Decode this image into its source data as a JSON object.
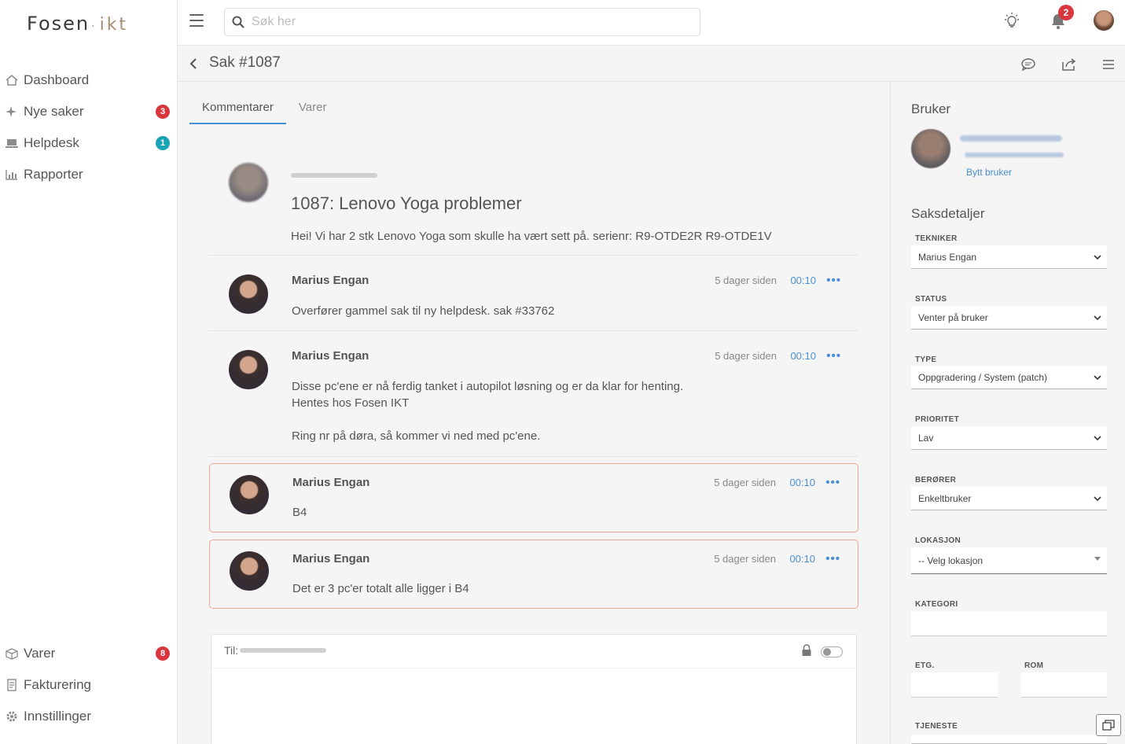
{
  "brand": {
    "name_part1": "Fosen",
    "name_dot": "·",
    "name_part2": "ikt"
  },
  "sidebar": {
    "items": [
      {
        "label": "Dashboard",
        "icon": "home-icon"
      },
      {
        "label": "Nye saker",
        "icon": "sparkle-icon",
        "badge": "3"
      },
      {
        "label": "Helpdesk",
        "icon": "laptop-icon",
        "badge": "1"
      },
      {
        "label": "Rapporter",
        "icon": "chart-icon"
      }
    ],
    "bottom_items": [
      {
        "label": "Varer",
        "icon": "box-icon",
        "badge": "8"
      },
      {
        "label": "Fakturering",
        "icon": "document-icon"
      },
      {
        "label": "Innstillinger",
        "icon": "gear-icon"
      }
    ]
  },
  "topbar": {
    "search_placeholder": "Søk her",
    "notification_count": "2"
  },
  "case": {
    "title": "Sak #1087"
  },
  "tabs": [
    {
      "label": "Kommentarer",
      "active": true
    },
    {
      "label": "Varer",
      "active": false
    }
  ],
  "original_post": {
    "title": "1087: Lenovo Yoga problemer",
    "body": "Hei! Vi har 2 stk Lenovo Yoga som skulle ha vært sett på. serienr: R9-OTDE2R R9-OTDE1V"
  },
  "comments": [
    {
      "author": "Marius Engan",
      "time": "5 dager siden",
      "duration": "00:10",
      "lines": [
        "Overfører gammel sak til ny helpdesk. sak #33762"
      ]
    },
    {
      "author": "Marius Engan",
      "time": "5 dager siden",
      "duration": "00:10",
      "lines": [
        "Disse pc'ene er nå ferdig tanket i autopilot løsning og er da klar for henting.",
        "Hentes hos Fosen IKT",
        "",
        "Ring nr på døra, så kommer vi ned med pc'ene."
      ]
    },
    {
      "author": "Marius Engan",
      "time": "5 dager siden",
      "duration": "00:10",
      "lines": [
        "B4"
      ]
    },
    {
      "author": "Marius Engan",
      "time": "5 dager siden",
      "duration": "00:10",
      "lines": [
        "Det er 3 pc'er totalt alle ligger i B4"
      ]
    }
  ],
  "composer": {
    "to_label": "Til:"
  },
  "right_panel": {
    "user_heading": "Bruker",
    "change_user": "Bytt bruker",
    "details_heading": "Saksdetaljer",
    "fields": {
      "tekniker": {
        "label": "TEKNIKER",
        "value": "Marius Engan"
      },
      "status": {
        "label": "STATUS",
        "value": "Venter på bruker"
      },
      "type": {
        "label": "TYPE",
        "value": "Oppgradering / System (patch)"
      },
      "prioritet": {
        "label": "PRIORITET",
        "value": "Lav"
      },
      "berorer": {
        "label": "BERØRER",
        "value": "Enkeltbruker"
      },
      "lokasjon": {
        "label": "LOKASJON",
        "value": "-- Velg lokasjon"
      },
      "kategori": {
        "label": "KATEGORI",
        "value": ""
      },
      "etg": {
        "label": "ETG.",
        "value": ""
      },
      "rom": {
        "label": "ROM",
        "value": ""
      },
      "tjeneste": {
        "label": "TJENESTE"
      }
    }
  }
}
